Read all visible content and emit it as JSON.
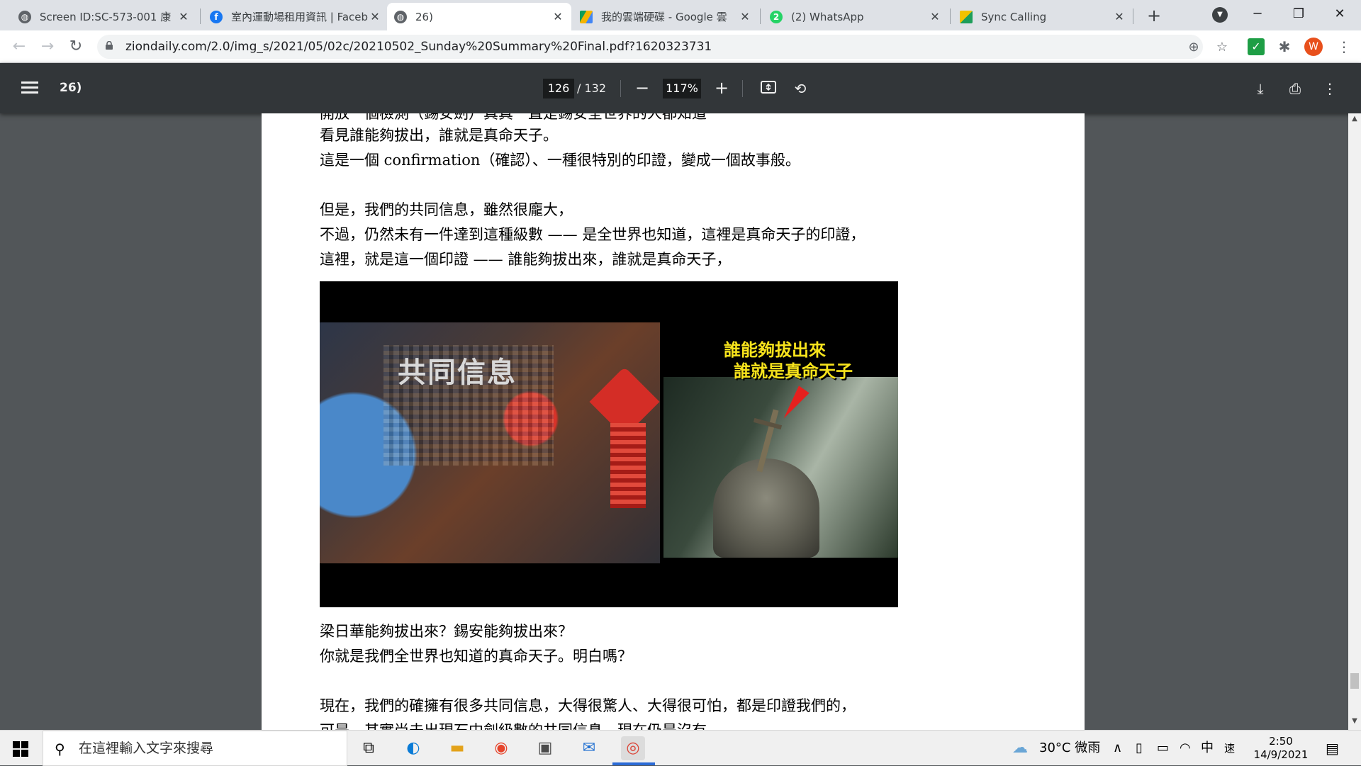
{
  "browser": {
    "tabs": [
      {
        "title": "Screen ID:SC-573-001 康",
        "favicon": "globe-icon",
        "active": false
      },
      {
        "title": "室內運動場租用資訊 | Faceb",
        "favicon": "facebook-icon",
        "active": false
      },
      {
        "title": "26)",
        "favicon": "globe-icon",
        "active": true
      },
      {
        "title": "我的雲端硬碟 - Google 雲",
        "favicon": "google-drive-icon",
        "active": false
      },
      {
        "title": "(2) WhatsApp",
        "favicon": "whatsapp-icon",
        "active": false
      },
      {
        "title": "Sync Calling",
        "favicon": "sync-calling-icon",
        "active": false
      }
    ],
    "close_glyph": "✕",
    "new_tab_glyph": "+",
    "url": "ziondaily.com/2.0/img_s/2021/05/02c/20210502_Sunday%20Summary%20Final.pdf?1620323731",
    "avatar_letter": "W",
    "whatsapp_badge": "2"
  },
  "pdf_toolbar": {
    "title": "26)",
    "current_page": "126",
    "total_pages": "/ 132",
    "zoom": "117%",
    "zoom_out": "−",
    "zoom_in": "+"
  },
  "document": {
    "lines": [
      "開放一個檢測（錫安劍）真真一直是錫安全世界的人都知道",
      "看見誰能夠拔出，誰就是真命天子。",
      "這是一個 confirmation（確認）、一種很特別的印證，變成一個故事般。",
      "但是，我們的共同信息，雖然很龐大，",
      "不過，仍然未有一件達到這種級數 —— 是全世界也知道，這裡是真命天子的印證，",
      "這裡，就是這一個印證 —— 誰能夠拔出來，誰就是真命天子，",
      "梁日華能夠拔出來？錫安能夠拔出來？",
      "你就是我們全世界也知道的真命天子。明白嗎？",
      "現在，我們的確擁有很多共同信息，大得很驚人、大得很可怕，都是印證我們的，",
      "可是，其實尚未出現石中劍級數的共同信息，現在仍是沒有。"
    ],
    "slide": {
      "left_title": "共同信息",
      "right_title_line1": "誰能夠拔出來",
      "right_title_line2": "誰就是真命天子"
    }
  },
  "taskbar": {
    "search_placeholder": "在這裡輸入文字來搜尋",
    "weather": "30°C 微雨",
    "ime": "中",
    "ime_mode": "速",
    "time": "2:50",
    "date": "14/9/2021"
  },
  "colors": {
    "pdf_toolbar": "#323639",
    "viewer_background": "#525659",
    "avatar": "#e8501c",
    "slide_title_yellow": "#f7e31c"
  }
}
